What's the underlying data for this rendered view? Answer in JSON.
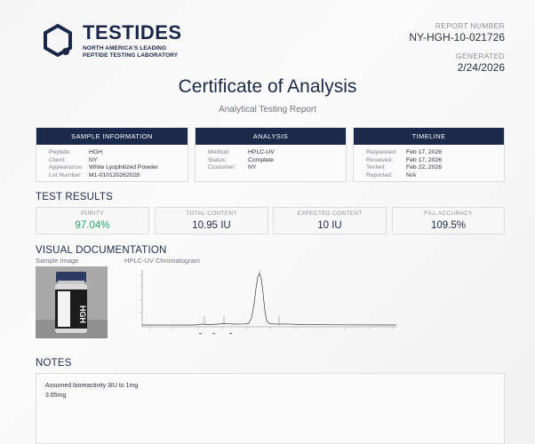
{
  "header": {
    "brand_name": "TESTIDES",
    "tagline_1": "NORTH AMERICA'S LEADING",
    "tagline_2": "PEPTIDE TESTING LABORATORY",
    "report_number_label": "REPORT NUMBER",
    "report_number": "NY-HGH-10-021726",
    "generated_label": "GENERATED",
    "generated": "2/24/2026"
  },
  "title": "Certificate of Analysis",
  "subtitle": "Analytical Testing Report",
  "panels": {
    "sample": {
      "heading": "SAMPLE INFORMATION",
      "rows": [
        {
          "k": "Peptide:",
          "v": "HGH"
        },
        {
          "k": "Client:",
          "v": "NY"
        },
        {
          "k": "Appearance:",
          "v": "White Lyophilized Powder"
        },
        {
          "k": "Lot Number:",
          "v": "M1-010120262028"
        }
      ]
    },
    "analysis": {
      "heading": "ANALYSIS",
      "rows": [
        {
          "k": "Method:",
          "v": "HPLC-UV"
        },
        {
          "k": "Status:",
          "v": "Complete"
        },
        {
          "k": "Customer:",
          "v": "NY"
        }
      ]
    },
    "timeline": {
      "heading": "TIMELINE",
      "rows": [
        {
          "k": "Requested:",
          "v": "Feb 17, 2026"
        },
        {
          "k": "Received:",
          "v": "Feb 17, 2026"
        },
        {
          "k": "Tested:",
          "v": "Feb 22, 2026"
        },
        {
          "k": "Reported:",
          "v": "N/A"
        }
      ]
    }
  },
  "test_results": {
    "heading": "TEST RESULTS",
    "metrics": [
      {
        "label": "PURITY",
        "value": "97.04%"
      },
      {
        "label": "TOTAL CONTENT",
        "value": "10.95 IU"
      },
      {
        "label": "EXPECTED CONTENT",
        "value": "10 IU"
      },
      {
        "label": "FILL ACCURACY",
        "value": "109.5%"
      }
    ]
  },
  "visual": {
    "heading": "VISUAL DOCUMENTATION",
    "sample_image_caption": "Sample Image",
    "vial_label": "HGH",
    "chromatogram_caption": "HPLC-UV Chromatogram"
  },
  "notes": {
    "heading": "NOTES",
    "line_1": "Assumed bioreactivity 3IU to 1mg",
    "line_2": "3.65mg"
  },
  "colors": {
    "navy": "#1b2a4b",
    "purity_green": "#2aa36b"
  }
}
